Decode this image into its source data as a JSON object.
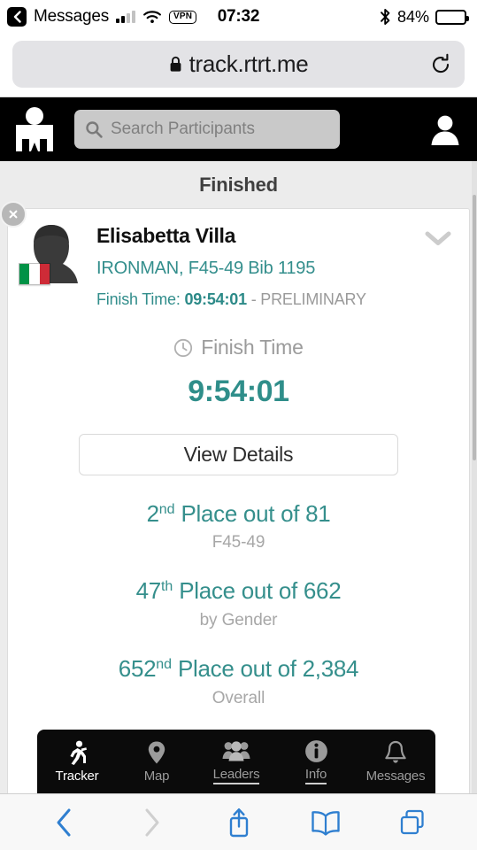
{
  "status_bar": {
    "back_label": "Messages",
    "back_icon": "chevron-left-icon",
    "signal_icon": "cellular-signal-icon",
    "wifi_icon": "wifi-icon",
    "vpn_badge": "VPN",
    "time": "07:32",
    "bluetooth_icon": "bluetooth-icon",
    "battery_percent": "84%",
    "battery_level": 84
  },
  "browser": {
    "lock_icon": "lock-icon",
    "url": "track.rtrt.me",
    "reload_icon": "reload-icon",
    "toolbar": {
      "back_icon": "chevron-left-icon",
      "forward_icon": "chevron-right-icon",
      "share_icon": "share-icon",
      "bookmarks_icon": "book-icon",
      "tabs_icon": "tabs-icon"
    }
  },
  "app_header": {
    "logo_icon": "ironman-mdot-logo-icon",
    "search_icon": "search-icon",
    "search_placeholder": "Search Participants",
    "profile_icon": "person-icon"
  },
  "main": {
    "section_title": "Finished",
    "close_icon": "close-icon",
    "expand_icon": "chevron-down-icon",
    "athlete": {
      "avatar_icon": "avatar-silhouette-icon",
      "flag": "italy-flag",
      "name": "Elisabetta Villa",
      "details": "IRONMAN, F45-49 Bib 1195",
      "finish_prefix": "Finish Time:",
      "finish_value": "09:54:01",
      "finish_status": "- PRELIMINARY"
    },
    "finish": {
      "clock_icon": "clock-icon",
      "label": "Finish Time",
      "value": "9:54:01"
    },
    "details_button": "View Details",
    "placements": [
      {
        "rank": "2",
        "suffix": "nd",
        "text": "Place out of 81",
        "sub": "F45-49"
      },
      {
        "rank": "47",
        "suffix": "th",
        "text": "Place out of 662",
        "sub": "by Gender"
      },
      {
        "rank": "652",
        "suffix": "nd",
        "text": "Place out of 2,384",
        "sub": "Overall"
      }
    ]
  },
  "tabbar": {
    "tabs": [
      {
        "label": "Tracker",
        "icon": "runner-icon",
        "active": true
      },
      {
        "label": "Map",
        "icon": "map-pin-icon",
        "active": false
      },
      {
        "label": "Leaders",
        "icon": "people-icon",
        "active": false
      },
      {
        "label": "Info",
        "icon": "info-circle-icon",
        "active": false
      },
      {
        "label": "Messages",
        "icon": "bell-icon",
        "active": false
      }
    ]
  },
  "colors": {
    "teal": "#2f8e8a",
    "header_black": "#000000",
    "safari_blue": "#2f7fd0",
    "page_gray": "#ececec"
  }
}
